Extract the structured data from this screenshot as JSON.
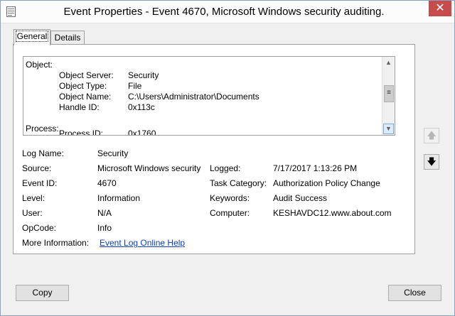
{
  "window": {
    "title": "Event Properties - Event 4670, Microsoft Windows security auditing.",
    "close_glyph": "✕"
  },
  "tabs": [
    {
      "label": "General",
      "selected": true
    },
    {
      "label": "Details",
      "selected": false
    }
  ],
  "description": {
    "object_header": "Object:",
    "fields": [
      {
        "key": "Object Server:",
        "value": "Security"
      },
      {
        "key": "Object Type:",
        "value": "File"
      },
      {
        "key": "Object Name:",
        "value": "C:\\Users\\Administrator\\Documents"
      },
      {
        "key": "Handle ID:",
        "value": "0x113c"
      }
    ],
    "process_header": "Process:",
    "process_partial": {
      "key": "Process ID:",
      "value": "0x1760"
    }
  },
  "details": {
    "log_name": {
      "label": "Log Name:",
      "value": "Security"
    },
    "source": {
      "label": "Source:",
      "value": "Microsoft Windows security"
    },
    "logged": {
      "label": "Logged:",
      "value": "7/17/2017 1:13:26 PM"
    },
    "event_id": {
      "label": "Event ID:",
      "value": "4670"
    },
    "task_category": {
      "label": "Task Category:",
      "value": "Authorization Policy Change"
    },
    "level": {
      "label": "Level:",
      "value": "Information"
    },
    "keywords": {
      "label": "Keywords:",
      "value": "Audit Success"
    },
    "user": {
      "label": "User:",
      "value": "N/A"
    },
    "computer": {
      "label": "Computer:",
      "value": "KESHAVDC12.www.about.com"
    },
    "opcode": {
      "label": "OpCode:",
      "value": "Info"
    },
    "more_info": {
      "label": "More Information:",
      "link": "Event Log Online Help"
    }
  },
  "buttons": {
    "copy": "Copy",
    "close": "Close",
    "up_icon": "up-arrow-icon",
    "down_icon": "down-arrow-icon"
  },
  "colors": {
    "close_button": "#c74b4b",
    "link": "#0b3dbd"
  }
}
